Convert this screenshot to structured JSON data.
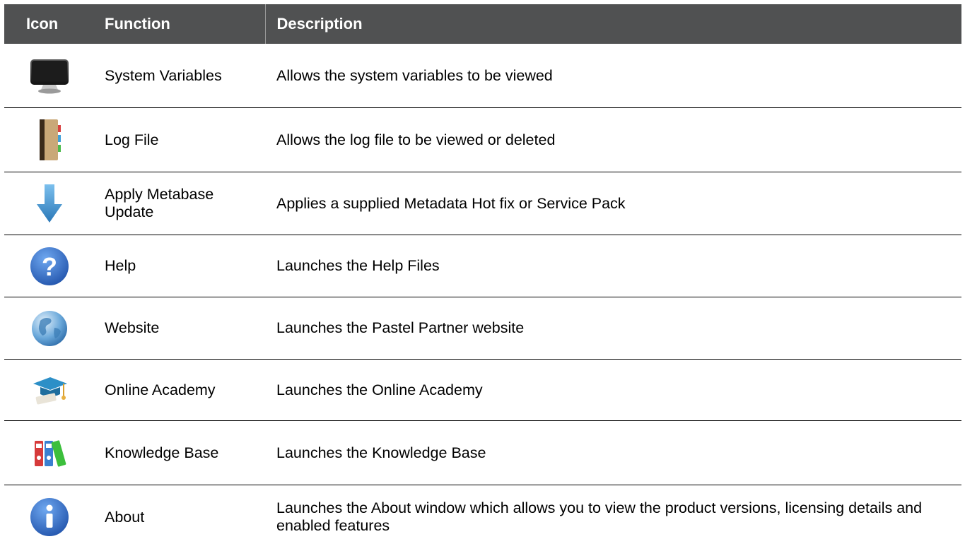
{
  "table": {
    "headers": {
      "icon": "Icon",
      "function": "Function",
      "description": "Description"
    },
    "rows": [
      {
        "icon": "monitor-icon",
        "function": "System Variables",
        "description": "Allows the system variables to be viewed"
      },
      {
        "icon": "notebook-icon",
        "function": "Log File",
        "description": "Allows the log file to be viewed or deleted"
      },
      {
        "icon": "download-arrow-icon",
        "function": "Apply Metabase Update",
        "description": "Applies a supplied Metadata Hot fix or Service Pack"
      },
      {
        "icon": "help-icon",
        "function": "Help",
        "description": "Launches the Help Files"
      },
      {
        "icon": "globe-icon",
        "function": "Website",
        "description": "Launches the Pastel Partner website"
      },
      {
        "icon": "graduation-cap-icon",
        "function": "Online Academy",
        "description": "Launches the Online Academy"
      },
      {
        "icon": "binders-icon",
        "function": "Knowledge Base",
        "description": "Launches the Knowledge Base"
      },
      {
        "icon": "info-icon",
        "function": "About",
        "description": "Launches the About window which allows you to view the product versions, licensing details and enabled features"
      }
    ]
  },
  "colors": {
    "header_bg": "#505152",
    "header_text": "#ffffff",
    "row_divider": "#000000",
    "arrow_blue": "#3a8fd0",
    "icon_blue": "#2f6fc4"
  }
}
